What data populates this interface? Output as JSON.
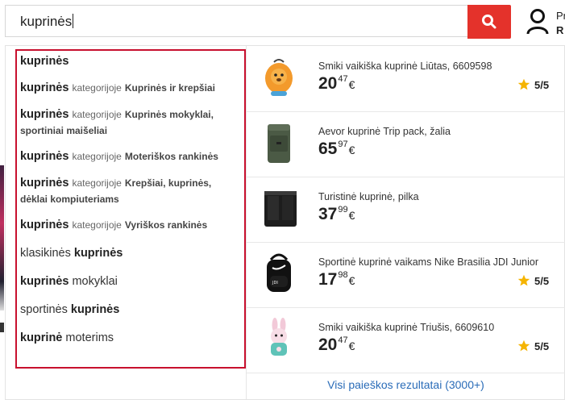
{
  "search": {
    "query": "kuprinės"
  },
  "user": {
    "line1": "Pr",
    "line2": "R"
  },
  "suggestions": [
    {
      "bold": "kuprinės",
      "cat_label": "",
      "cat_name": "",
      "plain": ""
    },
    {
      "bold": "kuprinės",
      "cat_label": "kategorijoje",
      "cat_name": "Kuprinės ir krepšiai",
      "plain": ""
    },
    {
      "bold": "kuprinės",
      "cat_label": "kategorijoje",
      "cat_name": "Kuprinės mokyklai, sportiniai maišeliai",
      "plain": ""
    },
    {
      "bold": "kuprinės",
      "cat_label": "kategorijoje",
      "cat_name": "Moteriškos rankinės",
      "plain": ""
    },
    {
      "bold": "kuprinės",
      "cat_label": "kategorijoje",
      "cat_name": "Krepšiai, kuprinės, dėklai kompiuteriams",
      "plain": ""
    },
    {
      "bold": "kuprinės",
      "cat_label": "kategorijoje",
      "cat_name": "Vyriškos rankinės",
      "plain": ""
    },
    {
      "pre": "klasikinės",
      "bold": "kuprinės"
    },
    {
      "bold": "kuprinės",
      "plain": "mokyklai"
    },
    {
      "pre": "sportinės",
      "bold": "kuprinės"
    },
    {
      "bold": "kuprinė",
      "plain": "moterims"
    }
  ],
  "products": [
    {
      "title": "Smiki vaikiška kuprinė Liūtas, 6609598",
      "price_int": "20",
      "price_dec": "47",
      "currency": "€",
      "rating": "5/5"
    },
    {
      "title": "Aevor kuprinė Trip pack, žalia",
      "price_int": "65",
      "price_dec": "97",
      "currency": "€",
      "rating": ""
    },
    {
      "title": "Turistinė kuprinė, pilka",
      "price_int": "37",
      "price_dec": "99",
      "currency": "€",
      "rating": ""
    },
    {
      "title": "Sportinė kuprinė vaikams Nike Brasilia JDI Junior",
      "price_int": "17",
      "price_dec": "98",
      "currency": "€",
      "rating": "5/5"
    },
    {
      "title": "Smiki vaikiška kuprinė Triušis, 6609610",
      "price_int": "20",
      "price_dec": "47",
      "currency": "€",
      "rating": "5/5"
    }
  ],
  "all_results_label": "Visi paieškos rezultatai (3000+)",
  "colors": {
    "accent": "#e4322b",
    "highlight_border": "#c8102e",
    "link": "#2a6cb8",
    "star": "#f5b400"
  }
}
